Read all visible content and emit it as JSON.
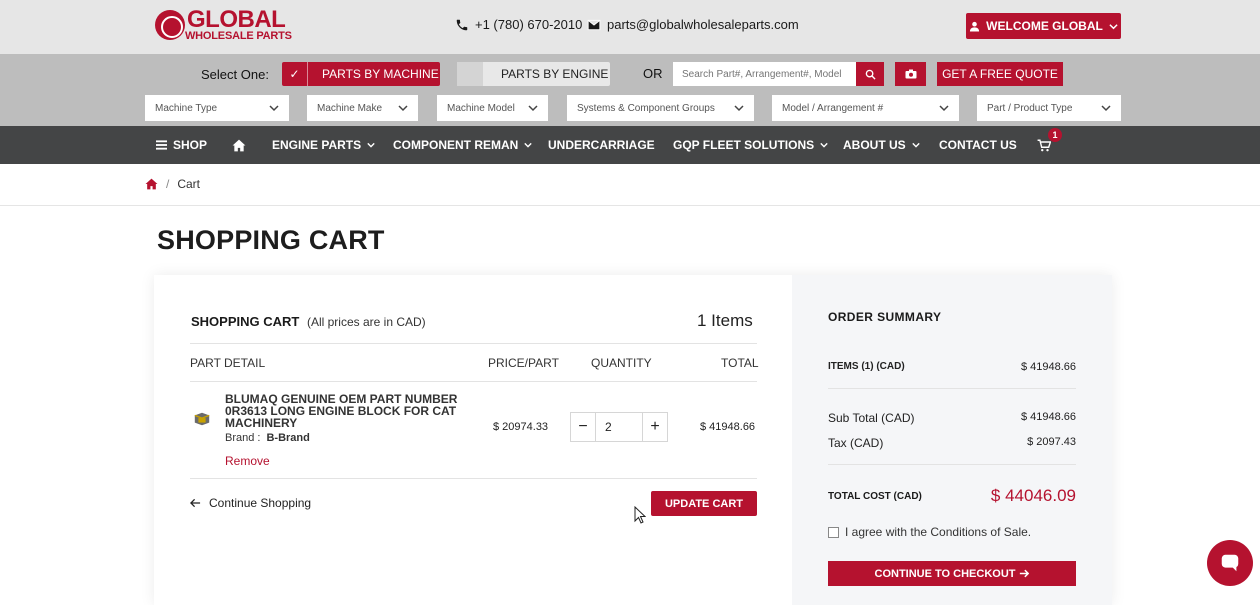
{
  "header": {
    "logo_line1": "GLOBAL",
    "logo_line2": "WHOLESALE PARTS",
    "phone": "+1 (780) 670-2010",
    "email": "parts@globalwholesaleparts.com",
    "welcome_label": "WELCOME GLOBAL"
  },
  "search": {
    "select_one": "Select One:",
    "by_machine": "PARTS BY MACHINE",
    "by_engine": "PARTS BY ENGINE",
    "or": "OR",
    "placeholder": "Search Part#, Arrangement#, Model",
    "quote_label": "GET A FREE QUOTE",
    "dropdowns": [
      "Machine Type",
      "Machine Make",
      "Machine Model",
      "Systems & Component Groups",
      "Model / Arrangement #",
      "Part / Product Type"
    ]
  },
  "nav": {
    "shop": "SHOP",
    "engine_parts": "ENGINE PARTS",
    "component_reman": "COMPONENT REMAN",
    "undercarriage": "UNDERCARRIAGE",
    "gqp": "GQP FLEET SOLUTIONS",
    "about": "ABOUT US",
    "contact": "CONTACT US",
    "cart_count": "1"
  },
  "breadcrumb": {
    "current": "Cart",
    "separator": "/"
  },
  "page_title": "SHOPPING CART",
  "cart": {
    "heading": "SHOPPING CART",
    "note": "(All prices are in CAD)",
    "items_count": "1 Items",
    "col_detail": "PART DETAIL",
    "col_price": "PRICE/PART",
    "col_qty": "QUANTITY",
    "col_total": "TOTAL",
    "item": {
      "name": "BLUMAQ GENUINE OEM PART NUMBER 0R3613 LONG ENGINE BLOCK FOR CAT MACHINERY",
      "brand_label": "Brand :",
      "brand_value": "B-Brand",
      "remove": "Remove",
      "price": "$ 20974.33",
      "qty": "2",
      "total": "$ 41948.66"
    },
    "continue_label": "Continue Shopping",
    "update_label": "UPDATE CART"
  },
  "summary": {
    "title": "ORDER SUMMARY",
    "items_label": "ITEMS (1) (CAD)",
    "items_value": "$ 41948.66",
    "subtotal_label": "Sub Total (CAD)",
    "subtotal_value": "$ 41948.66",
    "tax_label": "Tax (CAD)",
    "tax_value": "$ 2097.43",
    "total_label": "TOTAL COST (CAD)",
    "total_value": "$ 44046.09",
    "agree_label": "I agree with the Conditions of Sale.",
    "checkout_label": "CONTINUE TO CHECKOUT"
  },
  "colors": {
    "brand_red": "#b5122f",
    "nav_bg": "#444546",
    "top_bg": "#e6e6e6",
    "search_bg": "#bdbdbd"
  }
}
